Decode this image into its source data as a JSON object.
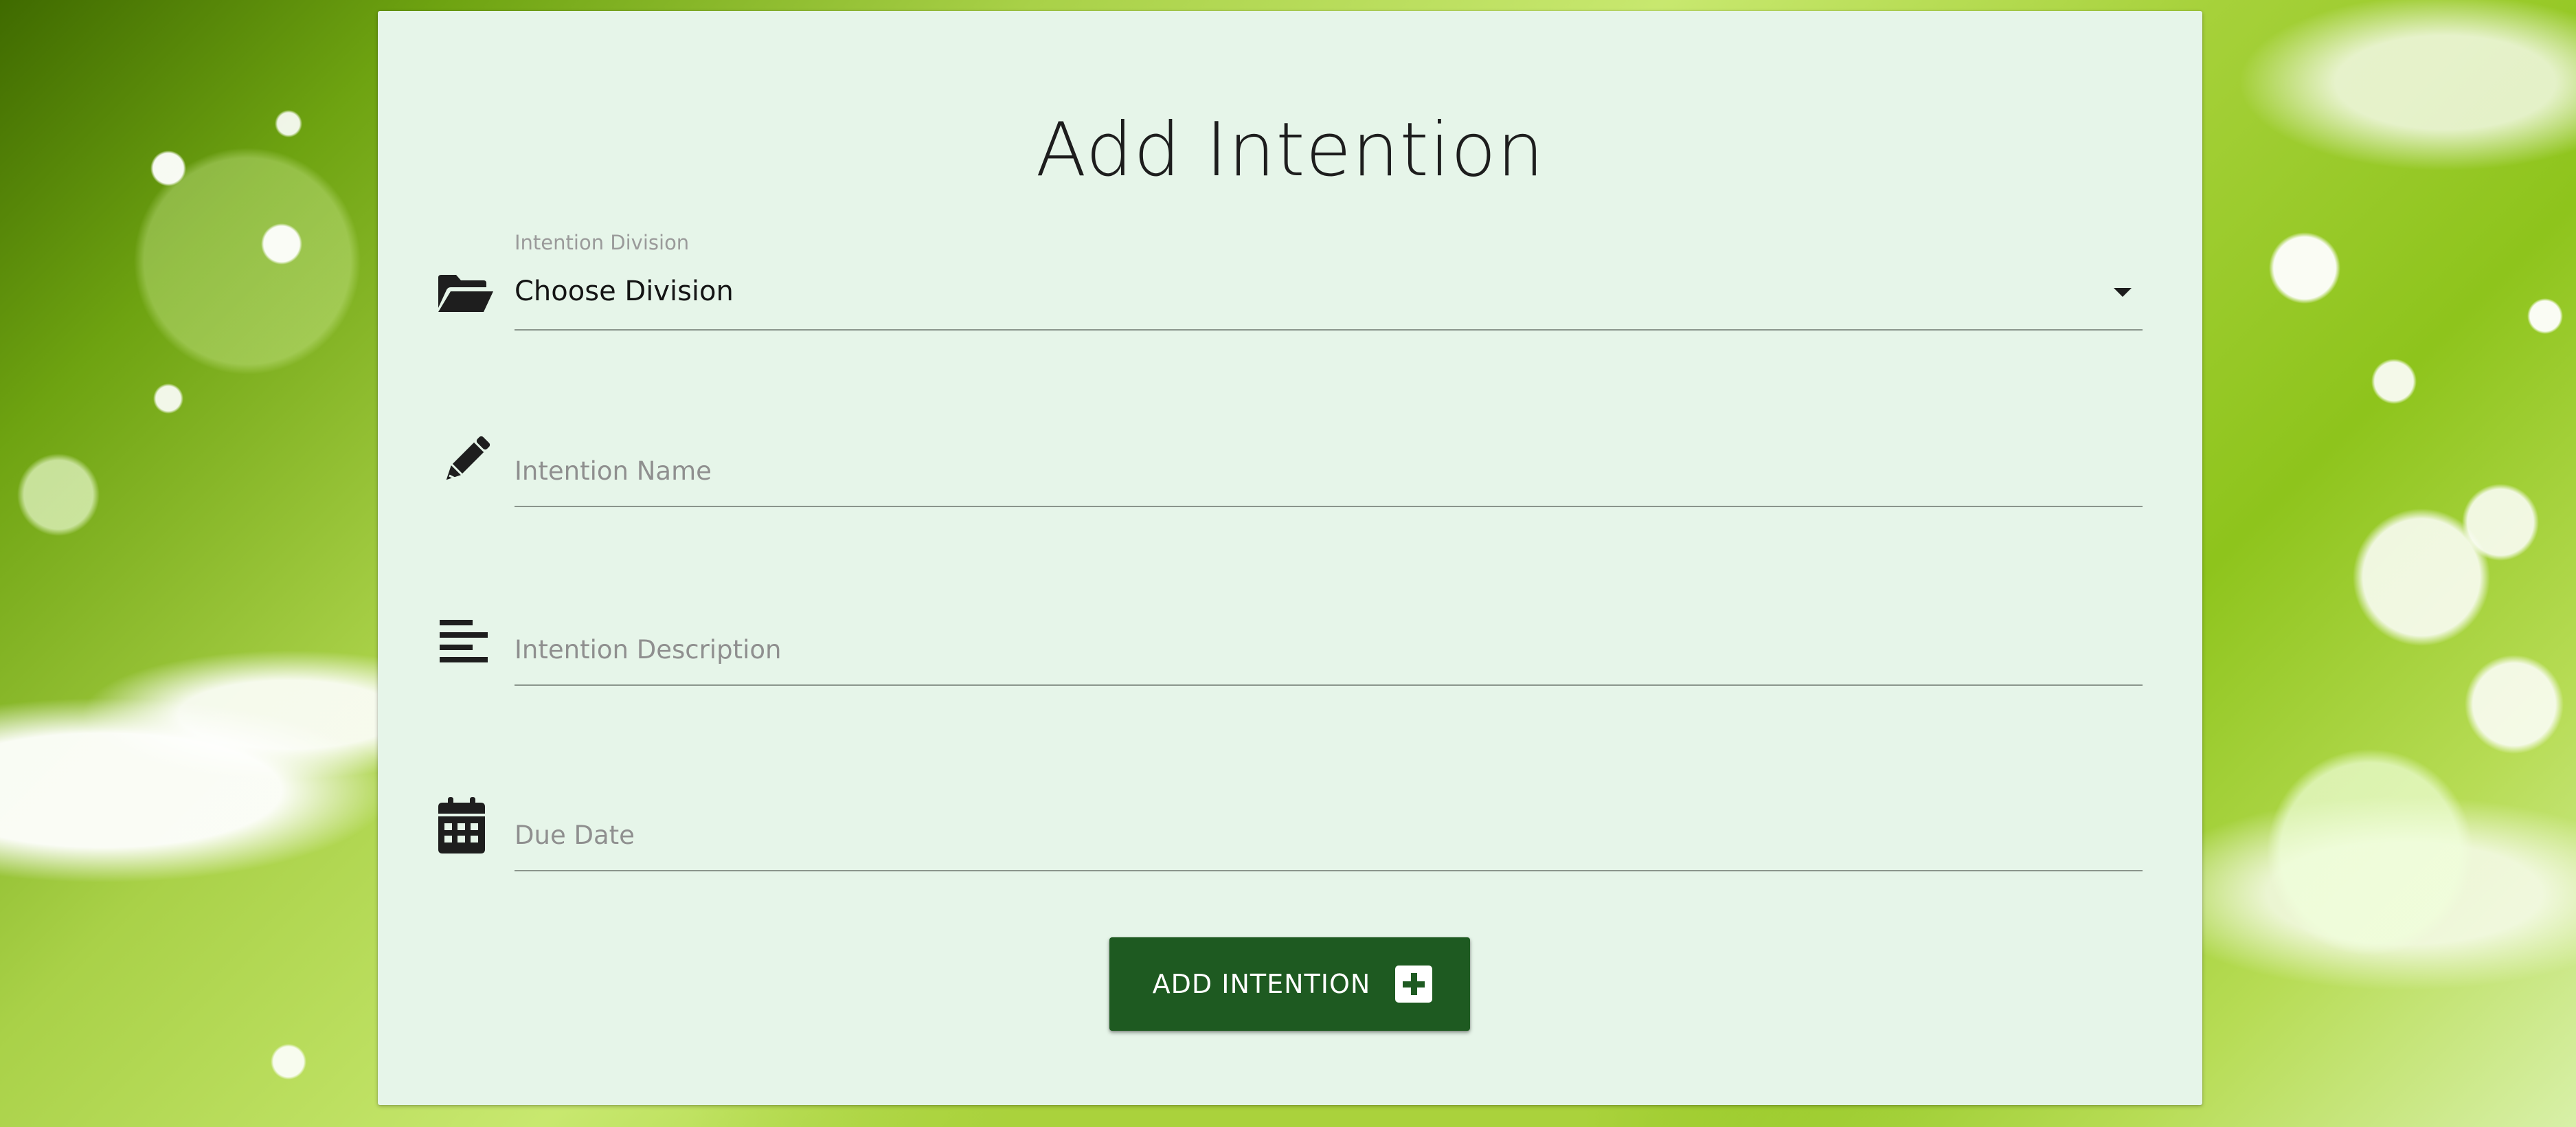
{
  "page": {
    "title": "Add Intention"
  },
  "form": {
    "division": {
      "label": "Intention Division",
      "value": "Choose Division",
      "icon": "folder-open-icon"
    },
    "name": {
      "placeholder": "Intention Name",
      "value": "",
      "icon": "pencil-icon"
    },
    "description": {
      "placeholder": "Intention Description",
      "value": "",
      "icon": "align-left-icon"
    },
    "due_date": {
      "placeholder": "Due Date",
      "value": "",
      "icon": "calendar-icon"
    },
    "submit": {
      "label": "ADD INTENTION",
      "icon": "plus-square-icon"
    }
  },
  "colors": {
    "card_background": "#e6f5e9",
    "button_background": "#1e5a21",
    "text": "#1d1d1d",
    "placeholder": "#8f8f8f"
  }
}
